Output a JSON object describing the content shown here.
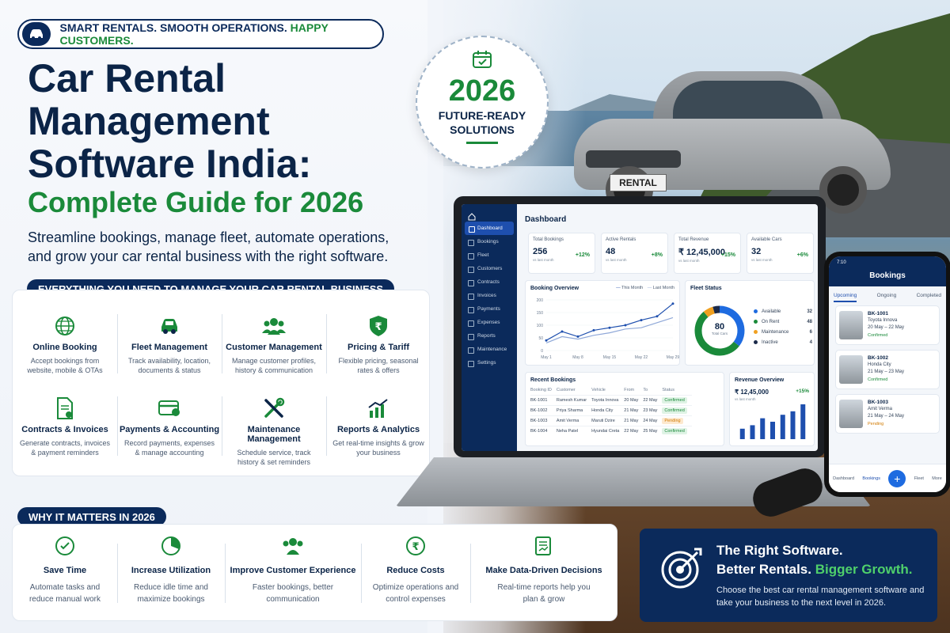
{
  "tagline": {
    "part1": "SMART RENTALS. SMOOTH OPERATIONS.",
    "part2": "HAPPY CUSTOMERS."
  },
  "title": {
    "line1": "Car Rental",
    "line2": "Management",
    "line3": "Software India:",
    "subtitle": "Complete Guide for 2026"
  },
  "lead": "Streamline bookings, manage fleet, automate operations, and grow your car rental business with the right software.",
  "badge": {
    "year": "2026",
    "line1": "FUTURE-READY",
    "line2": "SOLUTIONS"
  },
  "features_heading": "EVERYTHING YOU NEED TO MANAGE YOUR CAR RENTAL BUSINESS",
  "features": [
    {
      "title": "Online Booking",
      "desc": "Accept bookings from website, mobile & OTAs",
      "icon": "globe-icon"
    },
    {
      "title": "Fleet Management",
      "desc": "Track availability, location, documents & status",
      "icon": "car-icon"
    },
    {
      "title": "Customer Management",
      "desc": "Manage customer profiles, history & communication",
      "icon": "users-icon"
    },
    {
      "title": "Pricing & Tariff",
      "desc": "Flexible pricing, seasonal rates & offers",
      "icon": "rupee-shield-icon"
    },
    {
      "title": "Contracts & Invoices",
      "desc": "Generate contracts, invoices & payment reminders",
      "icon": "document-icon"
    },
    {
      "title": "Payments & Accounting",
      "desc": "Record payments, expenses & manage accounting",
      "icon": "card-icon"
    },
    {
      "title": "Maintenance Management",
      "desc": "Schedule service, track history & set reminders",
      "icon": "tools-icon"
    },
    {
      "title": "Reports & Analytics",
      "desc": "Get real-time insights & grow your business",
      "icon": "chart-icon"
    }
  ],
  "why_heading": "WHY IT MATTERS IN 2026",
  "why": [
    {
      "title": "Save Time",
      "line1": "Automate tasks and",
      "line2": "reduce manual work",
      "icon": "checklist-icon"
    },
    {
      "title": "Increase Utilization",
      "line1": "Reduce idle time and",
      "line2": "maximize bookings",
      "icon": "pie-icon"
    },
    {
      "title": "Improve Customer Experience",
      "line1": "Faster bookings, better",
      "line2": "communication",
      "icon": "users-icon"
    },
    {
      "title": "Reduce Costs",
      "line1": "Optimize operations and",
      "line2": "control expenses",
      "icon": "rupee-icon"
    },
    {
      "title": "Make Data-Driven Decisions",
      "line1": "Real-time reports help you",
      "line2": "plan & grow",
      "icon": "report-icon"
    }
  ],
  "cta": {
    "line1": "The Right Software.",
    "line2a": "Better Rentals.",
    "line2b": "Bigger Growth.",
    "desc": "Choose the best car rental management software and take your business to the next level in 2026."
  },
  "car_plate": "RENTAL",
  "dashboard": {
    "title": "Dashboard",
    "menu": [
      "Dashboard",
      "Bookings",
      "Fleet",
      "Customers",
      "Contracts",
      "Invoices",
      "Payments",
      "Expenses",
      "Reports",
      "Maintenance",
      "Settings"
    ],
    "kpis": [
      {
        "label": "Total Bookings",
        "value": "256",
        "change": "+12%",
        "sub": "vs last month"
      },
      {
        "label": "Active Rentals",
        "value": "48",
        "change": "+8%",
        "sub": "vs last month"
      },
      {
        "label": "Total Revenue",
        "value": "₹ 12,45,000",
        "change": "+15%",
        "sub": "vs last month"
      },
      {
        "label": "Available Cars",
        "value": "32",
        "change": "+6%",
        "sub": "vs last month"
      }
    ],
    "booking_overview": {
      "title": "Booking Overview",
      "legend": [
        "This Month",
        "Last Month"
      ],
      "yticks": [
        "200",
        "150",
        "100",
        "50",
        "0"
      ],
      "xticks": [
        "May 1",
        "May 8",
        "May 15",
        "May 22",
        "May 29"
      ]
    },
    "fleet_status": {
      "title": "Fleet Status",
      "total": "80",
      "total_label": "Total Cars",
      "items": [
        {
          "label": "Available",
          "value": "32",
          "color": "#1e6be0"
        },
        {
          "label": "On Rent",
          "value": "48",
          "color": "#1a8a3a"
        },
        {
          "label": "Maintenance",
          "value": "6",
          "color": "#f0a020"
        },
        {
          "label": "Inactive",
          "value": "4",
          "color": "#1b2a4a"
        }
      ]
    },
    "recent_bookings": {
      "title": "Recent Bookings",
      "columns": [
        "Booking ID",
        "Customer",
        "Vehicle",
        "From",
        "To",
        "Status"
      ],
      "rows": [
        [
          "BK-1001",
          "Ramesh Kumar",
          "Toyota Innova",
          "20 May",
          "22 May",
          "Confirmed"
        ],
        [
          "BK-1002",
          "Priya Sharma",
          "Honda City",
          "21 May",
          "23 May",
          "Confirmed"
        ],
        [
          "BK-1003",
          "Amit Verma",
          "Maruti Dzire",
          "21 May",
          "24 May",
          "Pending"
        ],
        [
          "BK-1004",
          "Neha Patel",
          "Hyundai Creta",
          "22 May",
          "25 May",
          "Confirmed"
        ]
      ]
    },
    "revenue_overview": {
      "title": "Revenue Overview",
      "value": "₹ 12,45,000",
      "sub": "vs last month",
      "change": "+15%"
    }
  },
  "phone": {
    "time": "7:10",
    "title": "Bookings",
    "tabs": [
      "Upcoming",
      "Ongoing",
      "Completed"
    ],
    "items": [
      {
        "id": "BK-1001",
        "name": "Toyota Innova",
        "dates": "20 May – 22 May",
        "status": "Confirmed"
      },
      {
        "id": "BK-1002",
        "name": "Honda City",
        "dates": "21 May – 23 May",
        "status": "Confirmed"
      },
      {
        "id": "BK-1003",
        "name": "Amit Verma",
        "dates": "21 May – 24 May",
        "status": "Pending"
      }
    ],
    "nav": [
      "Dashboard",
      "Bookings",
      "Fleet",
      "More"
    ]
  },
  "chart_data": [
    {
      "type": "line",
      "title": "Booking Overview",
      "x": [
        "May 1",
        "May 4",
        "May 8",
        "May 11",
        "May 15",
        "May 18",
        "May 22",
        "May 25",
        "May 29"
      ],
      "series": [
        {
          "name": "This Month",
          "values": [
            40,
            75,
            55,
            80,
            90,
            100,
            120,
            135,
            185
          ]
        },
        {
          "name": "Last Month",
          "values": [
            30,
            55,
            45,
            60,
            70,
            85,
            90,
            110,
            130
          ]
        }
      ],
      "ylim": [
        0,
        200
      ]
    },
    {
      "type": "pie",
      "title": "Fleet Status",
      "categories": [
        "Available",
        "On Rent",
        "Maintenance",
        "Inactive"
      ],
      "values": [
        32,
        48,
        6,
        4
      ]
    },
    {
      "type": "bar",
      "title": "Revenue Overview",
      "values": [
        3,
        4,
        6,
        5,
        7,
        8,
        10
      ]
    }
  ]
}
